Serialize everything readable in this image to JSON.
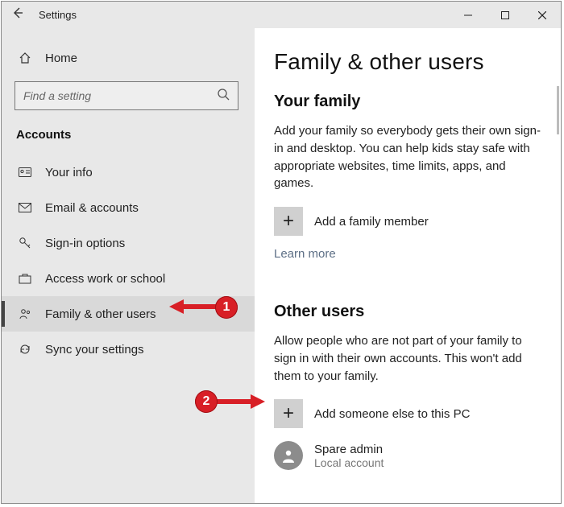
{
  "window": {
    "title": "Settings"
  },
  "sidebar": {
    "home_label": "Home",
    "search_placeholder": "Find a setting",
    "category": "Accounts",
    "items": [
      {
        "label": "Your info"
      },
      {
        "label": "Email & accounts"
      },
      {
        "label": "Sign-in options"
      },
      {
        "label": "Access work or school"
      },
      {
        "label": "Family & other users"
      },
      {
        "label": "Sync your settings"
      }
    ],
    "selected_index": 4
  },
  "main": {
    "heading": "Family & other users",
    "family": {
      "title": "Your family",
      "description": "Add your family so everybody gets their own sign-in and desktop. You can help kids stay safe with appropriate websites, time limits, apps, and games.",
      "add_label": "Add a family member",
      "learn_more": "Learn more"
    },
    "other": {
      "title": "Other users",
      "description": "Allow people who are not part of your family to sign in with their own accounts. This won't add them to your family.",
      "add_label": "Add someone else to this PC",
      "user": {
        "name": "Spare admin",
        "type": "Local account"
      }
    }
  },
  "annotations": {
    "badge1": "1",
    "badge2": "2"
  }
}
